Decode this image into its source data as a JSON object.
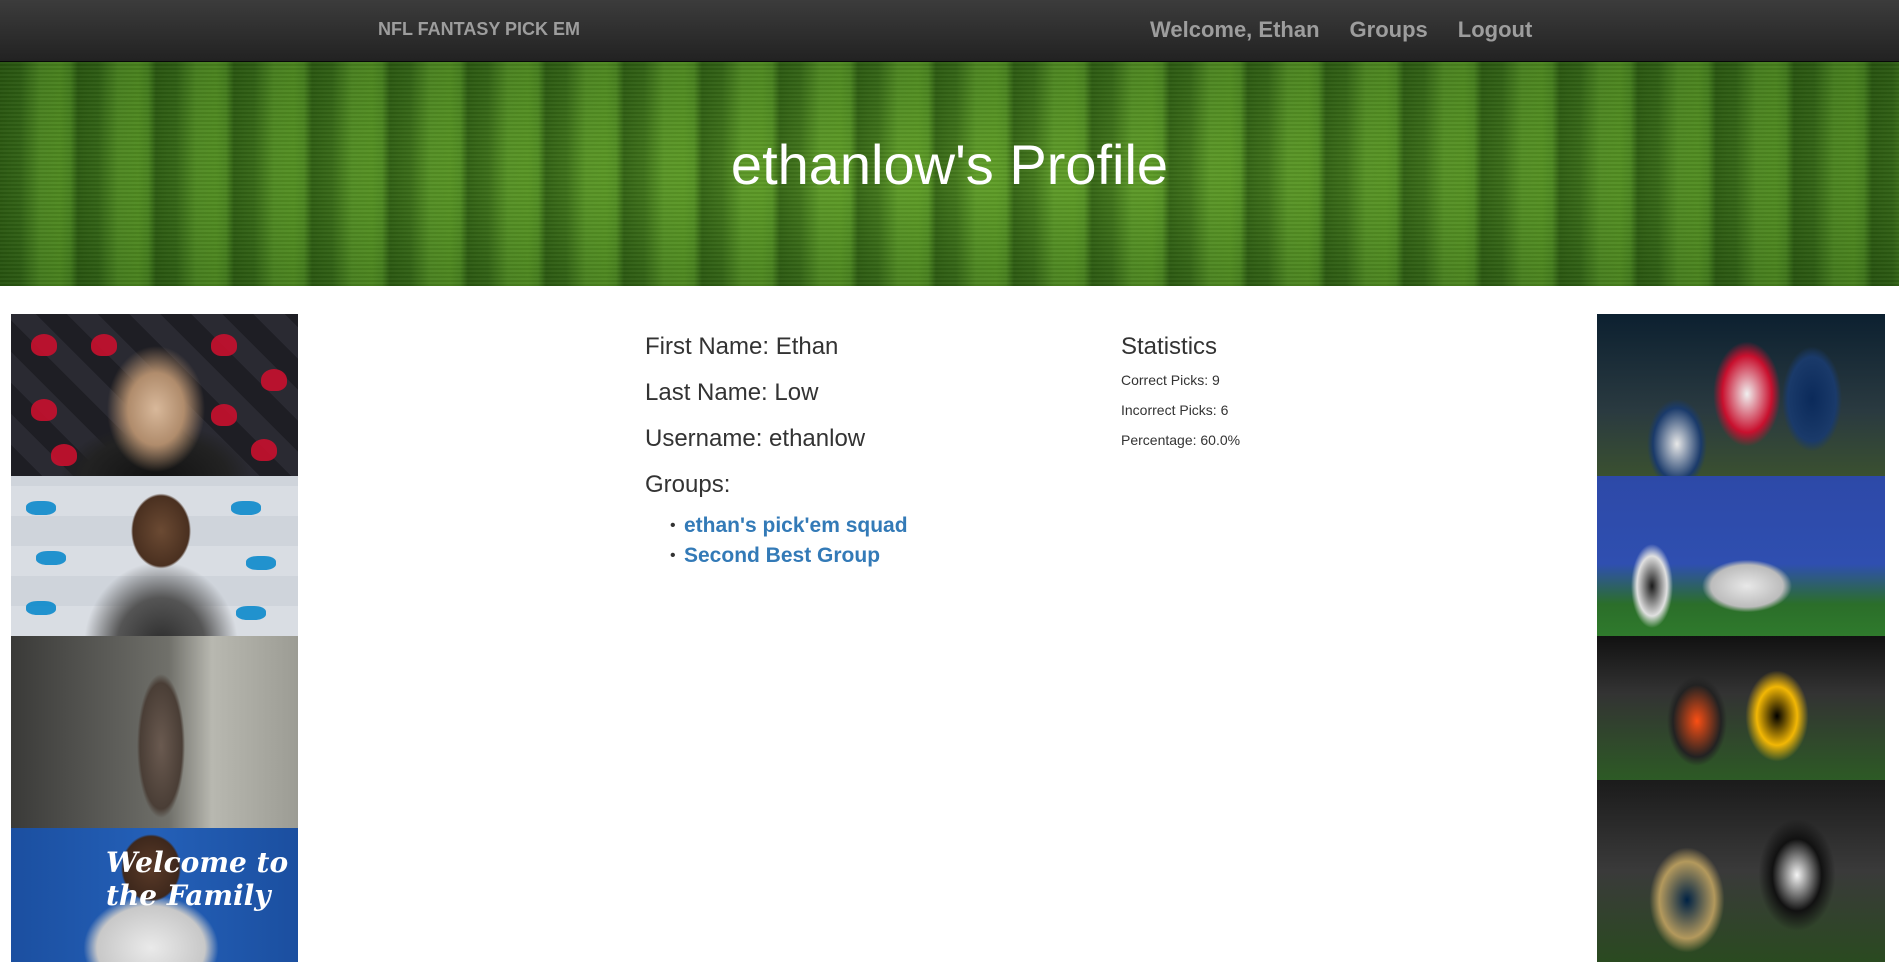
{
  "navbar": {
    "brand": "NFL FANTASY PICK EM",
    "links": [
      {
        "label": "Welcome, Ethan"
      },
      {
        "label": "Groups"
      },
      {
        "label": "Logout"
      }
    ]
  },
  "hero": {
    "title": "ethanlow's Profile"
  },
  "profile": {
    "first_name": {
      "label": "First Name:",
      "value": "Ethan"
    },
    "last_name": {
      "label": "Last Name:",
      "value": "Low"
    },
    "username": {
      "label": "Username:",
      "value": "ethanlow"
    },
    "groups_label": "Groups:",
    "groups": [
      "ethan's pick'em squad",
      "Second Best Group"
    ]
  },
  "statistics": {
    "title": "Statistics",
    "correct": {
      "label": "Correct Picks:",
      "value": "9"
    },
    "incorrect": {
      "label": "Incorrect Picks:",
      "value": "6"
    },
    "percentage": {
      "label": "Percentage:",
      "value": "60.0%"
    }
  },
  "side_photos": {
    "left_banner_text": "Welcome to the Family"
  },
  "colors": {
    "navbar_bg": "#222222",
    "nav_text": "#9d9d9d",
    "link_blue": "#337ab7",
    "hero_text": "#ffffff",
    "field_green": "#3f7a1c"
  }
}
